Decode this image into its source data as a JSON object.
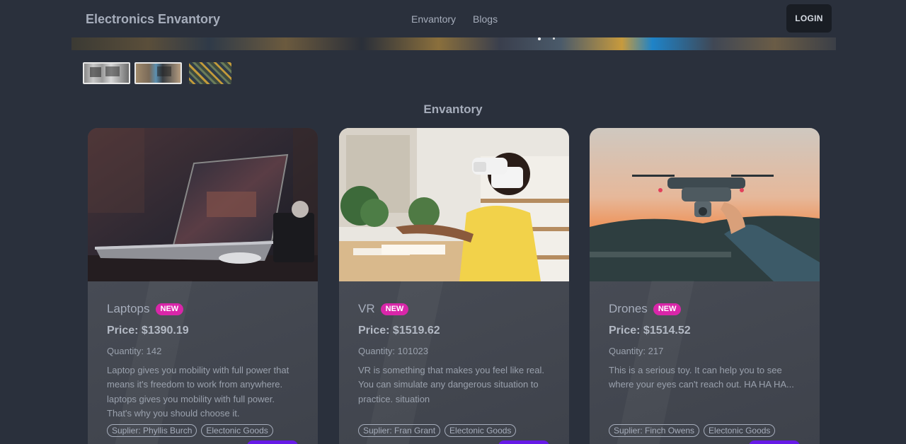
{
  "navbar": {
    "brand": "Electronics Envantory",
    "links": [
      "Envantory",
      "Blogs"
    ],
    "login_label": "LOGIN"
  },
  "section_title": "Envantory",
  "cards": [
    {
      "title": "Laptops",
      "badge": "NEW",
      "price": "Price: $1390.19",
      "quantity": "Quantity: 142",
      "description": "Laptop gives you mobility with full power that means it's freedom to work from anywhere. laptops gives you mobility with full power. That's why you should choose it.",
      "supplier": "Suplier: Phyllis Burch",
      "category": "Electonic Goods"
    },
    {
      "title": "VR",
      "badge": "NEW",
      "price": "Price: $1519.62",
      "quantity": "Quantity: 101023",
      "description": "VR is something that makes you feel like real. You can simulate any dangerous situation to practice. situation",
      "supplier": "Suplier: Fran Grant",
      "category": "Electonic Goods"
    },
    {
      "title": "Drones",
      "badge": "NEW",
      "price": "Price: $1514.52",
      "quantity": "Quantity: 217",
      "description": "This is a serious toy. It can help you to see where your eyes can't reach out. HA HA HA...",
      "supplier": "Suplier: Finch Owens",
      "category": "Electonic Goods"
    }
  ],
  "colors": {
    "background": "#2a303c",
    "badge": "#d926a9",
    "primary": "#661ae6",
    "login_bg": "#191d24"
  }
}
